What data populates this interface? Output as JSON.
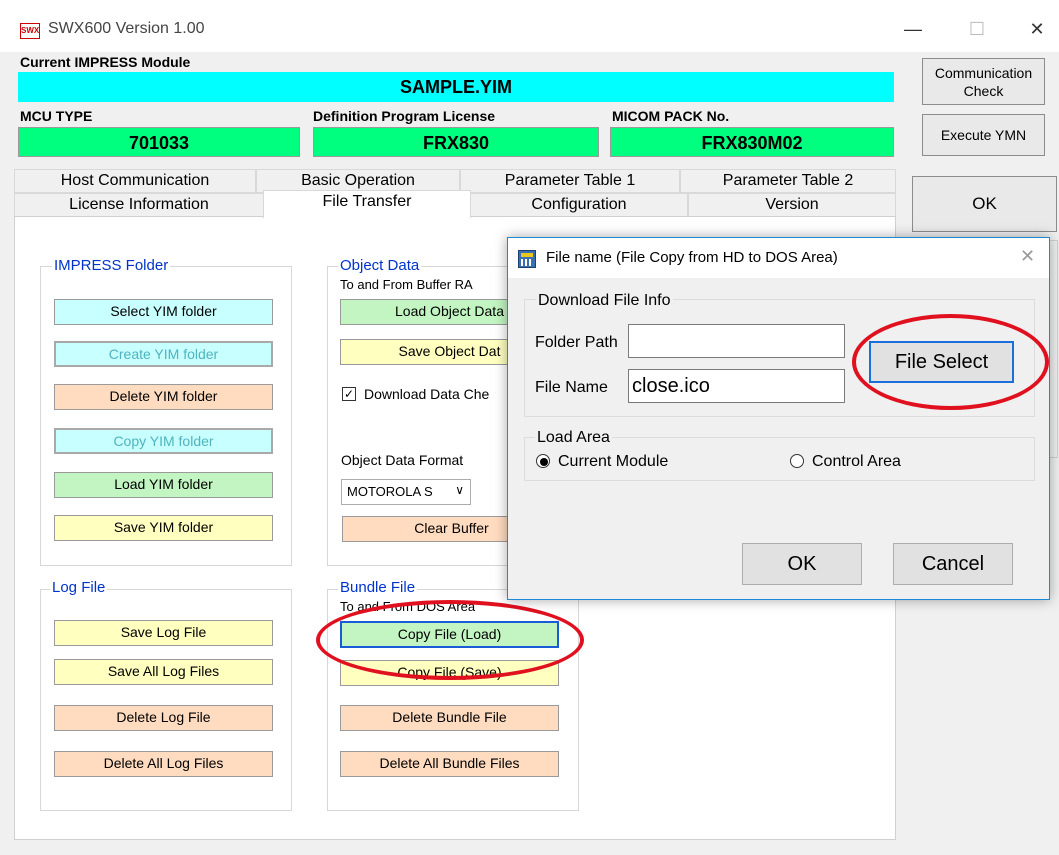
{
  "window": {
    "title": "SWX600   Version  1.00",
    "icon_text": "SWX"
  },
  "header": {
    "current_module_label": "Current IMPRESS Module",
    "current_module_value": "SAMPLE.YIM",
    "mcu_label": "MCU TYPE",
    "mcu_value": "701033",
    "def_label": "Definition Program License",
    "def_value": "FRX830",
    "micom_label": "MICOM PACK No.",
    "micom_value": "FRX830M02"
  },
  "side": {
    "comm_check": "Communication Check",
    "execute": "Execute YMN",
    "ok": "OK"
  },
  "tabs": {
    "row1": [
      "Host Communication",
      "Basic Operation",
      "Parameter Table 1",
      "Parameter Table 2"
    ],
    "row2": [
      "License Information",
      "File Transfer",
      "Configuration",
      "Version"
    ]
  },
  "impress": {
    "title": "IMPRESS Folder",
    "buttons": [
      "Select YIM folder",
      "Create YIM folder",
      "Delete YIM folder",
      "Copy YIM folder",
      "Load YIM folder",
      "Save YIM folder"
    ]
  },
  "object": {
    "title": "Object Data",
    "subtitle": "To and From Buffer RA",
    "load": "Load Object Data",
    "save": "Save Object Dat",
    "check_label": "Download Data Che",
    "format_label": "Object Data Format",
    "format_value": "MOTOROLA S",
    "clear": "Clear Buffer"
  },
  "log": {
    "title": "Log File",
    "buttons": [
      "Save Log File",
      "Save All Log Files",
      "Delete Log File",
      "Delete All Log Files"
    ]
  },
  "bundle": {
    "title": "Bundle File",
    "subtitle": "To and From DOS Area",
    "buttons": [
      "Copy File (Load)",
      "Copy File (Save)",
      "Delete Bundle File",
      "Delete All Bundle Files"
    ]
  },
  "dialog": {
    "title": "File name (File Copy from HD to DOS Area)",
    "info_group": "Download File Info",
    "folder_label": "Folder Path",
    "folder_value": "",
    "file_label": "File Name",
    "file_value": "close.ico",
    "file_select": "File Select",
    "area_group": "Load Area",
    "radio_current": "Current Module",
    "radio_control": "Control Area",
    "ok": "OK",
    "cancel": "Cancel"
  }
}
